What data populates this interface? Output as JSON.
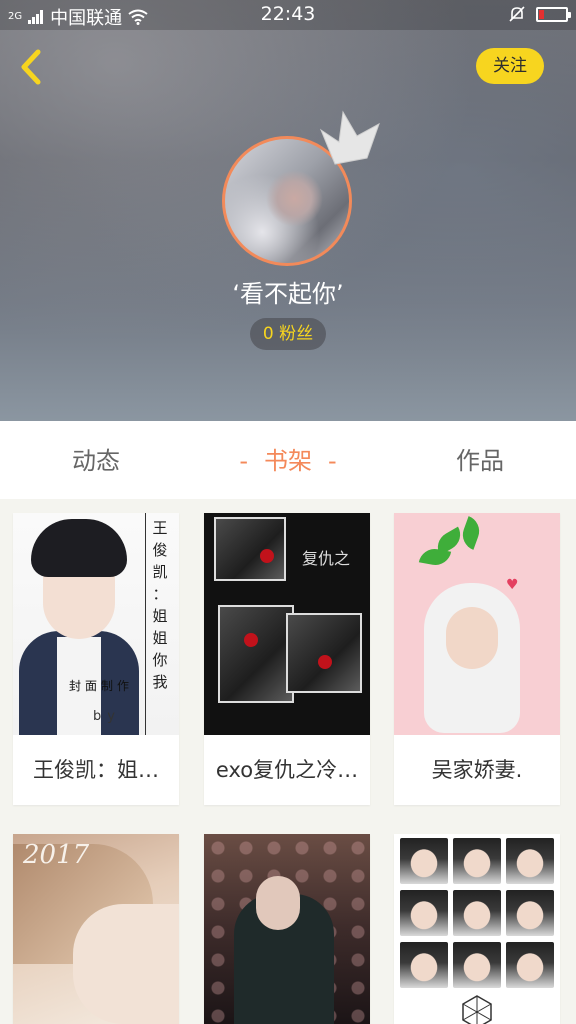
{
  "status_bar": {
    "signal": "2G",
    "carrier": "中国联通",
    "time": "22:43"
  },
  "profile": {
    "follow_label": "关注",
    "nickname": "‘看不起你’",
    "fans": "0 粉丝"
  },
  "tabs": [
    {
      "label": "动态"
    },
    {
      "label": "书架",
      "active": true
    },
    {
      "label": "作品"
    }
  ],
  "books": [
    {
      "title": "王俊凯：姐…",
      "cover_text": [
        "王",
        "俊",
        "凯",
        "：",
        "姐",
        "姐",
        "你",
        "我"
      ],
      "cover_caption": "封面制作",
      "cover_by": "by"
    },
    {
      "title": "exo复仇之冷…",
      "cover_title": "复仇之"
    },
    {
      "title": "吴家娇妻."
    },
    {
      "title": "",
      "cover_text": "2017"
    },
    {
      "title": ""
    },
    {
      "title": ""
    }
  ],
  "colors": {
    "accent": "#f4895a",
    "follow_button": "#f7d51f",
    "avatar_border": "#f28a5a"
  },
  "icons": {
    "back": "chevron-left-icon",
    "wifi": "wifi-icon",
    "mute": "bell-off-icon",
    "battery": "battery-low-icon",
    "crown": "crown-icon"
  }
}
